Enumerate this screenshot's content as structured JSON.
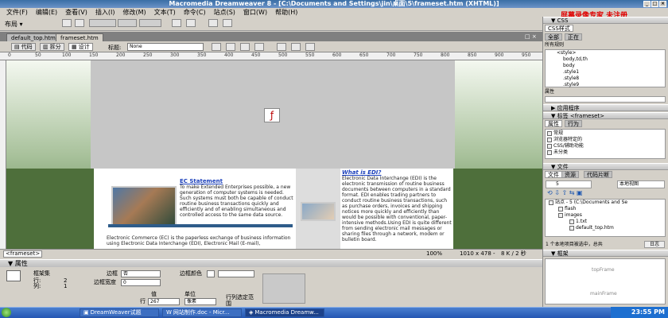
{
  "app": {
    "title": "Macromedia Dreamweaver 8 - [C:\\Documents and Settings\\jin\\桌面\\5\\frameset.htm (XHTML)]",
    "watermark": "屏幕录像专家 未注册"
  },
  "menu": [
    "文件(F)",
    "编辑(E)",
    "查看(V)",
    "插入(I)",
    "修改(M)",
    "文本(T)",
    "命令(C)",
    "站点(S)",
    "窗口(W)",
    "帮助(H)"
  ],
  "insert_bar": {
    "layout_label": "布局 ▾"
  },
  "doc_tabs": [
    {
      "label": "default_top.htm"
    },
    {
      "label": "frameset.htm"
    }
  ],
  "doc_toolbar": {
    "code": "代码",
    "split": "拆分",
    "design": "设计",
    "title_label": "标题:",
    "title_value": "None"
  },
  "ruler": [
    "0",
    "50",
    "100",
    "150",
    "200",
    "250",
    "300",
    "350",
    "400",
    "450",
    "500",
    "550",
    "600",
    "650",
    "700",
    "750",
    "800",
    "850",
    "900",
    "950"
  ],
  "page": {
    "ec_title": "EC Statement",
    "ec_text": "To make Extended Enterprises possible, a new generation of computer systems is needed. Such systems must both be capable of conduct routine business transactions quickly and efficiently and of enabling simultaneous and controlled access to the same data source.",
    "ec_bottom": "Electronic Commerce (EC) is the paperless exchange of business information using Electronic Data Interchange (EDI), Electronic Mail (E-mail),",
    "edi_title": "What is EDI?",
    "edi_text": "Electronic Data Interchange (EDI) is the electronic transmission of routine business documents between computers in a standard format. EDI enables trading partners to conduct routine business transactions, such as purchase orders, invoices and shipping notices more quickly and efficiently than would be possible with conventional, paper-intensive methods.Using EDI is quite different from sending electronic mail messages or sharing files through a network, modem or bulletin board."
  },
  "status": {
    "tag": "<frameset>",
    "zoom": "100%",
    "size": "1010 x 478 -",
    "weight": "8 K / 2 秒"
  },
  "properties": {
    "header": "▼ 属性",
    "frameset_label": "框架集",
    "row_label": "行:",
    "row_value": "2",
    "col_label": "列:",
    "col_value": "1",
    "border_label": "边框",
    "border_value": "否",
    "border_color_label": "边框颜色",
    "border_width_label": "边框宽度",
    "border_width_value": "0",
    "value_label": "值",
    "value_value": "267",
    "unit_label": "单位",
    "unit_value": "像素",
    "row_prefix": "行",
    "row_select_label": "行列选定范围"
  },
  "panels": {
    "css_header": "▼ CSS",
    "css_tab": "CSS样式",
    "all_label": "全部",
    "current_label": "正在",
    "all_rules_label": "所有规则",
    "rules": [
      "<style>",
      "body,td,th",
      "body",
      ".style1",
      ".style8",
      ".style9"
    ],
    "props_label": "属性",
    "app_header": "▶ 应用程序",
    "tag_header": "▼ 标签 <frameset>",
    "tag_tab_attr": "属性",
    "tag_tab_behavior": "行为",
    "attr_groups": [
      "常规",
      "浏览器特定的",
      "CSS/辅助功能",
      "未分类"
    ],
    "file_header": "▼ 文件",
    "file_tab": "文件",
    "resource_tab": "资源",
    "snippet_tab": "代码片断",
    "site_select": "5",
    "view_select": "本地视图",
    "tree": [
      "站点 - 5 (C:\\Documents and Se",
      "flash",
      "images",
      "1.txt",
      "default_top.htm"
    ],
    "file_status": "1 个本地项目被选中，总共",
    "log_button": "日志",
    "frames_header": "▼ 框架",
    "frame_top": "topFrame",
    "frame_main": "mainFrame"
  },
  "taskbar": {
    "items": [
      "DreamWeaver试题",
      "网站制作.doc - Micr...",
      "Macromedia Dreamw..."
    ],
    "clock": "23:55 PM"
  }
}
